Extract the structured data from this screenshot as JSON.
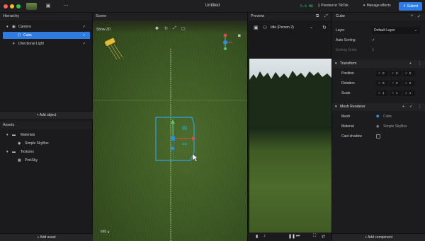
{
  "window": {
    "title": "Untitled",
    "memory": "5.6 MB",
    "preview_tiktok": "Preview in TikTok",
    "manage_effects": "Manage effects",
    "submit": "Submit"
  },
  "hierarchy": {
    "title": "Hierarchy",
    "items": [
      {
        "label": "Camera"
      },
      {
        "label": "Cube"
      },
      {
        "label": "Directional Light"
      }
    ],
    "add_object": "+ Add object"
  },
  "assets": {
    "title": "Assets",
    "items": [
      {
        "label": "Materials"
      },
      {
        "label": "Simple SkyBox"
      },
      {
        "label": "Textures"
      },
      {
        "label": "PinkSky"
      }
    ],
    "add_asset": "+ Add asset"
  },
  "scene": {
    "title": "Scene",
    "show_2d": "Show 2D",
    "info": "Info"
  },
  "preview": {
    "title": "Preview",
    "animation": "Idle (Person 2)"
  },
  "inspector": {
    "object_name": "Cube",
    "layer_label": "Layer",
    "layer_value": "Default Layer",
    "auto_sorting_label": "Auto Sorting",
    "sorting_order_label": "Sorting Order",
    "sorting_order_value": "0",
    "transform": {
      "title": "Transform",
      "position_label": "Position",
      "position": [
        "0",
        "0",
        "0"
      ],
      "rotation_label": "Rotation",
      "rotation": [
        "0",
        "0",
        "0"
      ],
      "scale_label": "Scale",
      "scale": [
        "1",
        "1",
        "1"
      ]
    },
    "mesh_renderer": {
      "title": "Mesh Renderer",
      "mesh_label": "Mesh",
      "mesh_value": "Cube",
      "material_label": "Material",
      "material_value": "Simple SkyBox",
      "cast_shadow_label": "Cast shadow"
    },
    "add_component": "+ Add component"
  }
}
